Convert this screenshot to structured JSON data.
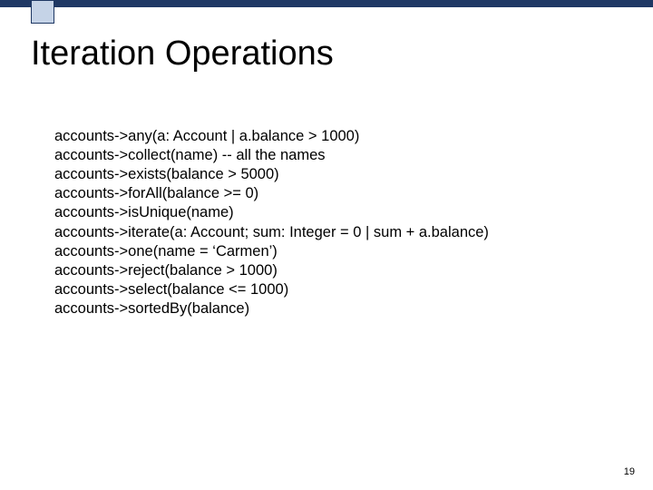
{
  "title": "Iteration Operations",
  "lines": [
    "accounts->any(a: Account | a.balance > 1000)",
    "accounts->collect(name) -- all the names",
    "accounts->exists(balance > 5000)",
    "accounts->forAll(balance >= 0)",
    "accounts->isUnique(name)",
    "accounts->iterate(a: Account; sum: Integer = 0 | sum + a.balance)",
    "accounts->one(name = ‘Carmen’)",
    "accounts->reject(balance > 1000)",
    "accounts->select(balance <= 1000)",
    "accounts->sortedBy(balance)"
  ],
  "page_number": "19"
}
